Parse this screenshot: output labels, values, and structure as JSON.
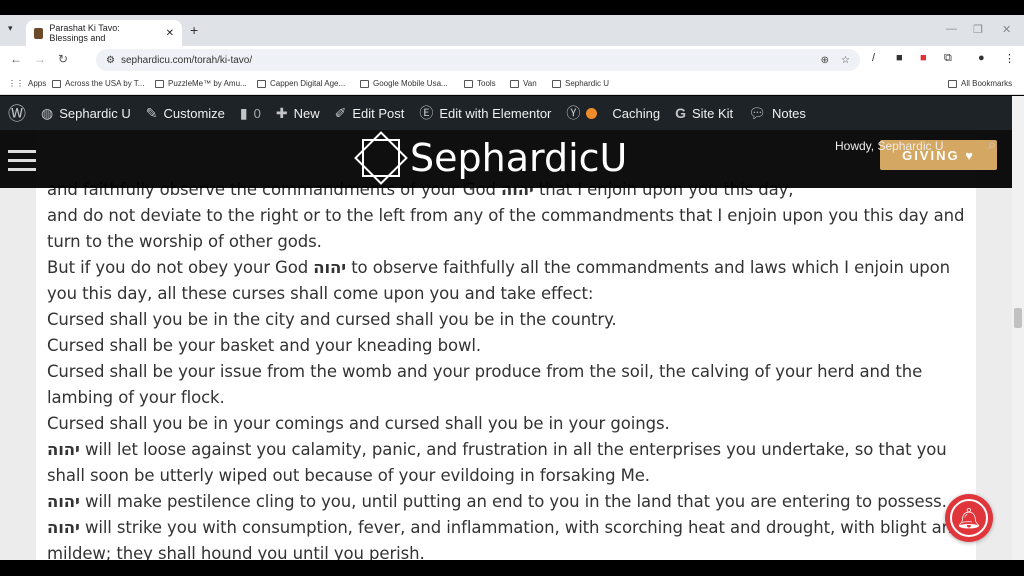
{
  "browser": {
    "tab_title": "Parashat Ki Tavo: Blessings and",
    "url": "sephardicu.com/torah/ki-tavo/",
    "bookmarks": [
      "Apps",
      "Across the USA by T...",
      "PuzzleMe™ by Amu...",
      "Cappen Digital Age...",
      "Google Mobile Usa...",
      "Tools",
      "Van",
      "Sephardic U"
    ],
    "all_bookmarks": "All Bookmarks"
  },
  "adminbar": {
    "items": [
      "Sephardic U",
      "Customize",
      "0",
      "New",
      "Edit Post",
      "Edit with Elementor",
      "Caching",
      "Site Kit",
      "Notes"
    ]
  },
  "header": {
    "logo": "SephardicU",
    "howdy": "Howdy, Sephardic U",
    "giving": "GIVING ♥"
  },
  "content": {
    "lines": [
      [
        "and faithfully observe the commandments of your God ",
        "יהוה",
        " that I enjoin upon you this day,"
      ],
      [
        "and do not deviate to the right or to the left from any of the commandments that I enjoin upon you this day and turn to the worship of other gods.",
        "",
        ""
      ],
      [
        "But if you do not obey your God ",
        "יהוה",
        " to observe faithfully all the commandments and laws which I enjoin upon you this day, all these curses shall come upon you and take effect:"
      ],
      [
        "Cursed shall you be in the city and cursed shall you be in the country.",
        "",
        ""
      ],
      [
        "Cursed shall be your basket and your kneading bowl.",
        "",
        ""
      ],
      [
        "Cursed shall be your issue from the womb and your produce from the soil, the calving of your herd and the lambing of your flock.",
        "",
        ""
      ],
      [
        "Cursed shall you be in your comings and cursed shall you be in your goings.",
        "",
        ""
      ],
      [
        "",
        "יהוה",
        " will let loose against you calamity, panic, and frustration in all the enterprises you undertake, so that you shall soon be utterly wiped out because of your evildoing in forsaking Me."
      ],
      [
        "",
        "יהוה",
        " will make pestilence cling to you, until putting an end to you in the land that you are entering to possess."
      ],
      [
        "",
        "יהוה",
        " will strike you with consumption, fever, and inflammation, with scorching heat and drought, with blight and mildew; they shall hound you until you perish."
      ]
    ]
  },
  "colors": {
    "admin_bar": "#1d2327",
    "giving": "#d4a762",
    "bell": "#e0353b"
  }
}
